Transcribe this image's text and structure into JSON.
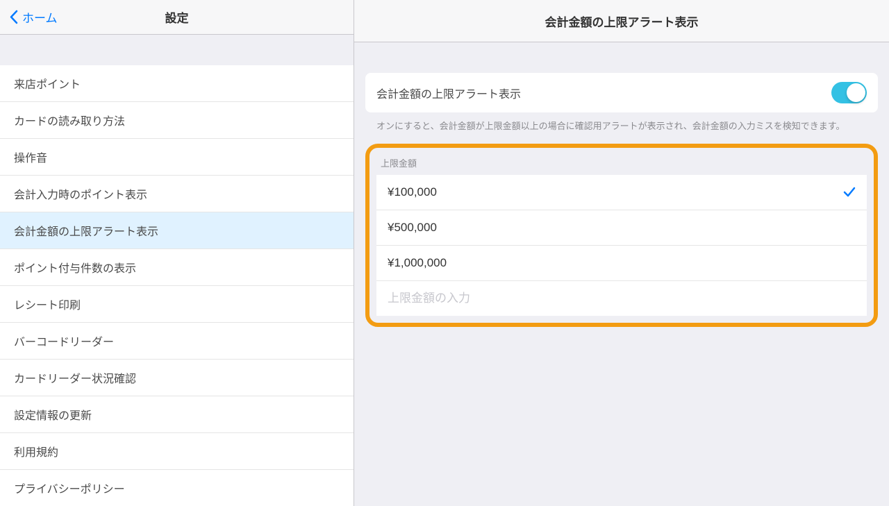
{
  "leftNav": {
    "backLabel": "ホーム",
    "title": "設定"
  },
  "rightNav": {
    "title": "会計金額の上限アラート表示"
  },
  "settingsItems": [
    {
      "label": "来店ポイント"
    },
    {
      "label": "カードの読み取り方法"
    },
    {
      "label": "操作音"
    },
    {
      "label": "会計入力時のポイント表示"
    },
    {
      "label": "会計金額の上限アラート表示",
      "selected": true
    },
    {
      "label": "ポイント付与件数の表示"
    },
    {
      "label": "レシート印刷"
    },
    {
      "label": "バーコードリーダー"
    },
    {
      "label": "カードリーダー状況確認"
    },
    {
      "label": "設定情報の更新"
    },
    {
      "label": "利用規約"
    },
    {
      "label": "プライバシーポリシー"
    }
  ],
  "toggle": {
    "label": "会計金額の上限アラート表示",
    "on": true
  },
  "description": "オンにすると、会計金額が上限金額以上の場合に確認用アラートが表示され、会計金額の入力ミスを検知できます。",
  "amountSection": {
    "header": "上限金額",
    "options": [
      {
        "value": "¥100,000",
        "selected": true
      },
      {
        "value": "¥500,000",
        "selected": false
      },
      {
        "value": "¥1,000,000",
        "selected": false
      }
    ],
    "inputPlaceholder": "上限金額の入力"
  }
}
